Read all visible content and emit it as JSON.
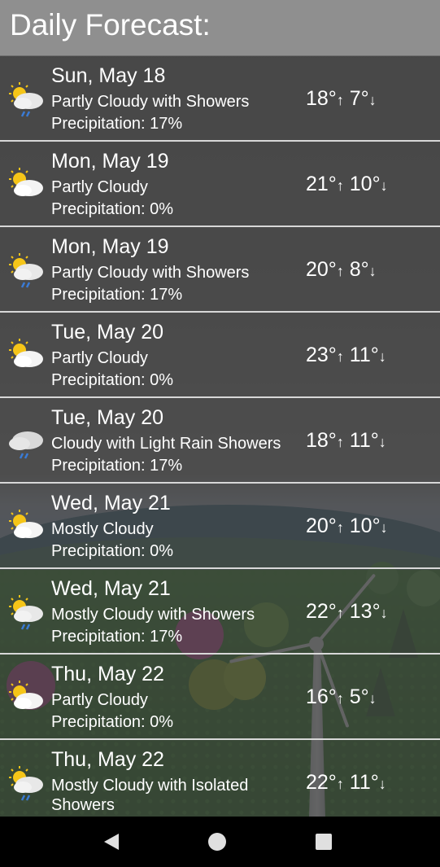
{
  "header": {
    "title": "Daily Forecast:"
  },
  "forecast": [
    {
      "date": "Sun, May 18",
      "condition": "Partly Cloudy with Showers",
      "precipitation": "Precipitation:  17%",
      "high": "18°",
      "low": "7°",
      "icon": "partly-cloudy-showers-icon"
    },
    {
      "date": "Mon, May 19",
      "condition": "Partly Cloudy",
      "precipitation": "Precipitation:  0%",
      "high": "21°",
      "low": "10°",
      "icon": "partly-cloudy-icon"
    },
    {
      "date": "Mon, May 19",
      "condition": "Partly Cloudy with Showers",
      "precipitation": "Precipitation:  17%",
      "high": "20°",
      "low": "8°",
      "icon": "partly-cloudy-showers-icon"
    },
    {
      "date": "Tue, May 20",
      "condition": "Partly Cloudy",
      "precipitation": "Precipitation:  0%",
      "high": "23°",
      "low": "11°",
      "icon": "partly-cloudy-icon"
    },
    {
      "date": "Tue, May 20",
      "condition": "Cloudy with Light Rain Showers",
      "precipitation": "Precipitation:  17%",
      "high": "18°",
      "low": "11°",
      "icon": "cloudy-rain-icon"
    },
    {
      "date": "Wed, May 21",
      "condition": "Mostly Cloudy",
      "precipitation": "Precipitation:  0%",
      "high": "20°",
      "low": "10°",
      "icon": "partly-cloudy-icon"
    },
    {
      "date": "Wed, May 21",
      "condition": "Mostly Cloudy with Showers",
      "precipitation": "Precipitation:  17%",
      "high": "22°",
      "low": "13°",
      "icon": "partly-cloudy-showers-icon"
    },
    {
      "date": "Thu, May 22",
      "condition": "Partly Cloudy",
      "precipitation": "Precipitation:  0%",
      "high": "16°",
      "low": "5°",
      "icon": "partly-cloudy-icon"
    },
    {
      "date": "Thu, May 22",
      "condition": "Mostly Cloudy with Isolated Showers",
      "precipitation": "",
      "high": "22°",
      "low": "11°",
      "icon": "partly-cloudy-showers-icon"
    }
  ],
  "arrows": {
    "up": "↑",
    "down": "↓"
  },
  "nav": {
    "back": "back-icon",
    "home": "home-icon",
    "recents": "recents-icon"
  }
}
